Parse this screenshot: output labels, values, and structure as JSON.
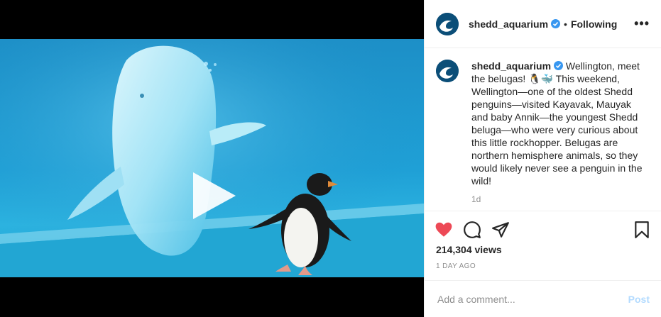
{
  "post": {
    "username": "shedd_aquarium",
    "separator": "•",
    "follow_status": "Following",
    "more_label": "•••",
    "caption": "Wellington, meet the belugas! 🐧🐳 This weekend, Wellington—one of the oldest Shedd penguins—visited Kayavak, Mauyak and baby Annik—the youngest Shedd beluga—who were very curious about this little rockhopper. Belugas are northern hemisphere animals, so they would likely never see a penguin in the wild!",
    "caption_time": "1d",
    "views": "214,304 views",
    "time_ago": "1 DAY AGO"
  },
  "comment_box": {
    "placeholder": "Add a comment...",
    "post_label": "Post"
  },
  "colors": {
    "like_red": "#ed4956",
    "verified_blue": "#3897f0",
    "avatar_blue": "#0b4e78",
    "post_disabled": "#b3dbff",
    "water": "#1fa7d8"
  },
  "icons": [
    "play-icon",
    "verified-icon",
    "heart-icon",
    "comment-icon",
    "share-icon",
    "bookmark-icon"
  ]
}
